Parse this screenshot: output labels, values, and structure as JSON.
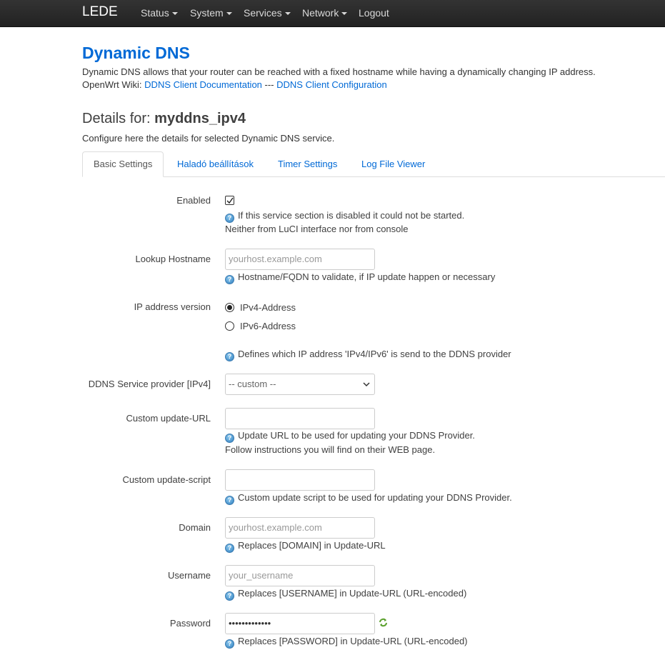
{
  "navbar": {
    "brand": "LEDE",
    "menu": [
      {
        "label": "Status",
        "dropdown": true
      },
      {
        "label": "System",
        "dropdown": true
      },
      {
        "label": "Services",
        "dropdown": true
      },
      {
        "label": "Network",
        "dropdown": true
      },
      {
        "label": "Logout",
        "dropdown": false
      }
    ]
  },
  "header": {
    "title": "Dynamic DNS",
    "description": "Dynamic DNS allows that your router can be reached with a fixed hostname while having a dynamically changing IP address.",
    "wiki_prefix": "OpenWrt Wiki: ",
    "wiki_link1": "DDNS Client Documentation",
    "wiki_sep": " --- ",
    "wiki_link2": "DDNS Client Configuration"
  },
  "section": {
    "title_prefix": "Details for: ",
    "title_name": "myddns_ipv4",
    "description": "Configure here the details for selected Dynamic DNS service."
  },
  "tabs": [
    {
      "label": "Basic Settings",
      "active": true
    },
    {
      "label": "Haladó beállítások",
      "active": false
    },
    {
      "label": "Timer Settings",
      "active": false
    },
    {
      "label": "Log File Viewer",
      "active": false
    }
  ],
  "form": {
    "enabled": {
      "label": "Enabled",
      "checked": true,
      "help1": "If this service section is disabled it could not be started.",
      "help2": "Neither from LuCI interface nor from console"
    },
    "lookup_hostname": {
      "label": "Lookup Hostname",
      "value": "",
      "placeholder": "yourhost.example.com",
      "help": "Hostname/FQDN to validate, if IP update happen or necessary"
    },
    "ip_version": {
      "label": "IP address version",
      "options": [
        {
          "label": "IPv4-Address",
          "selected": true
        },
        {
          "label": "IPv6-Address",
          "selected": false
        }
      ],
      "help": "Defines which IP address 'IPv4/IPv6' is send to the DDNS provider"
    },
    "service_provider": {
      "label": "DDNS Service provider [IPv4]",
      "selected": "-- custom --"
    },
    "update_url": {
      "label": "Custom update-URL",
      "value": "",
      "help1": "Update URL to be used for updating your DDNS Provider.",
      "help2": "Follow instructions you will find on their WEB page."
    },
    "update_script": {
      "label": "Custom update-script",
      "value": "",
      "help": "Custom update script to be used for updating your DDNS Provider."
    },
    "domain": {
      "label": "Domain",
      "value": "",
      "placeholder": "yourhost.example.com",
      "help": "Replaces [DOMAIN] in Update-URL"
    },
    "username": {
      "label": "Username",
      "value": "",
      "placeholder": "your_username",
      "help": "Replaces [USERNAME] in Update-URL (URL-encoded)"
    },
    "password": {
      "label": "Password",
      "masked_value": "•••••••••••••",
      "help": "Replaces [PASSWORD] in Update-URL (URL-encoded)"
    }
  },
  "icons": {
    "help": "help-icon",
    "reveal": "reveal-password-icon"
  },
  "colors": {
    "link": "#0069d6",
    "navbar": "#222222",
    "help_icon": "#2f7fbf",
    "reveal_icon": "#5aa02c"
  }
}
